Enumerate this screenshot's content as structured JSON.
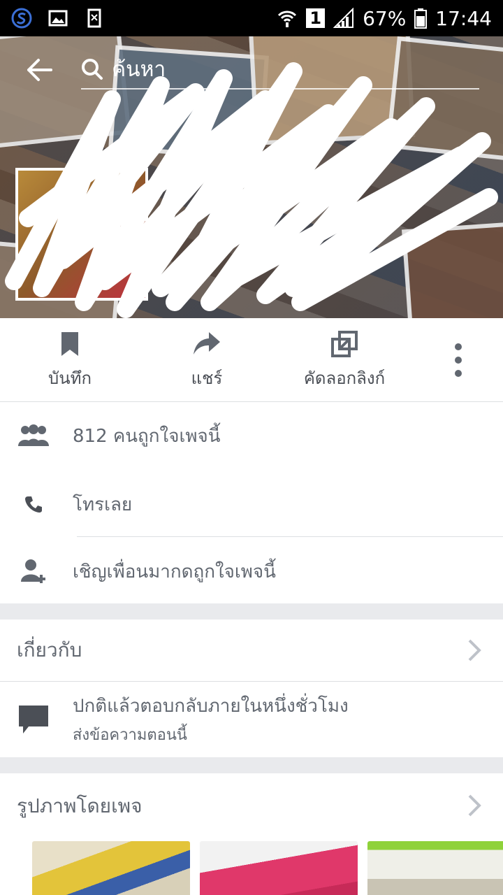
{
  "status_bar": {
    "battery": "67%",
    "time": "17:44",
    "signal_sim": "1"
  },
  "toolbar": {
    "search_placeholder": "ค้นหา"
  },
  "actions": {
    "save_label": "บันทึก",
    "share_label": "แชร์",
    "copy_link_label": "คัดลอกลิงก์"
  },
  "info": {
    "likes_text": "812 คนถูกใจเพจนี้",
    "call_text": "โทรเลย",
    "invite_text": "เชิญเพื่อนมากดถูกใจเพจนี้"
  },
  "about": {
    "title": "เกี่ยวกับ",
    "response_text": "ปกติแล้วตอบกลับภายในหนึ่งชั่วโมง",
    "message_link": "ส่งข้อความตอนนี้"
  },
  "photos": {
    "title": "รูปภาพโดยเพจ"
  },
  "colors": {
    "icon_gray": "#616770",
    "divider": "#dddfe2",
    "background": "#e9eaed"
  }
}
